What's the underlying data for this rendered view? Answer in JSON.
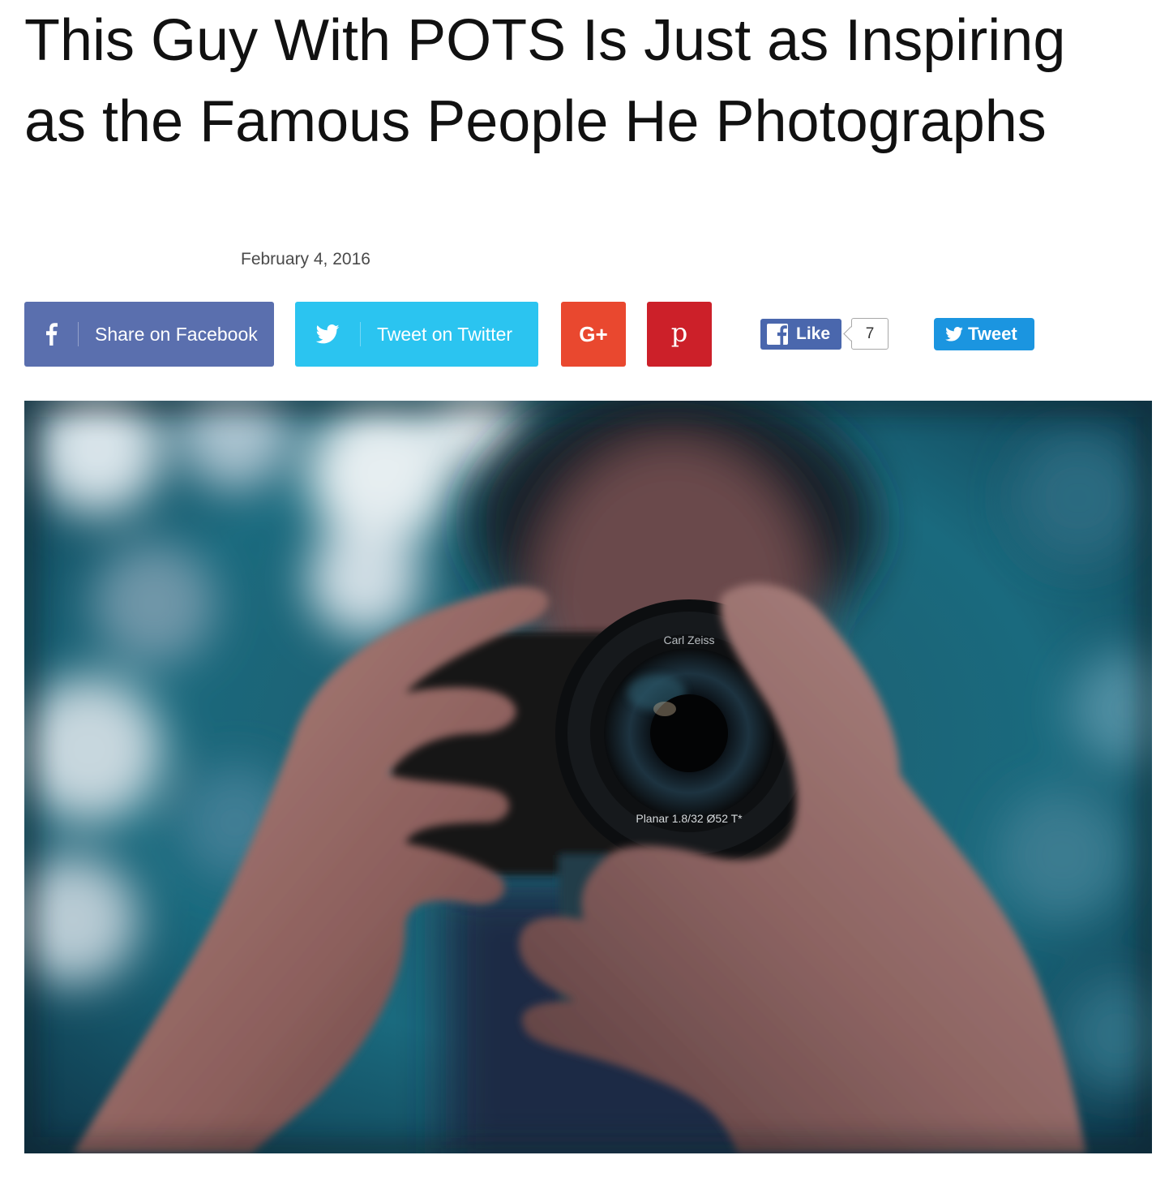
{
  "article": {
    "title": "This Guy With POTS Is Just as Inspiring as the Famous People He Photographs",
    "date": "February 4, 2016"
  },
  "share_bar": {
    "facebook_label": "Share on Facebook",
    "twitter_label": "Tweet on Twitter",
    "googleplus_label": "G+",
    "pinterest_label": "p",
    "like_label": "Like",
    "like_count": "7",
    "tweet_label": "Tweet"
  },
  "colors": {
    "facebook": "#5a6fae",
    "twitter": "#2bc4f0",
    "googleplus": "#e9482f",
    "pinterest": "#cc2029",
    "fb_like": "#4a67ad",
    "tweet": "#1b95e0"
  },
  "hero_image": {
    "lens_text_top": "Carl Zeiss",
    "lens_text_bottom": "Planar  1.8/32  Ø52  T*"
  }
}
